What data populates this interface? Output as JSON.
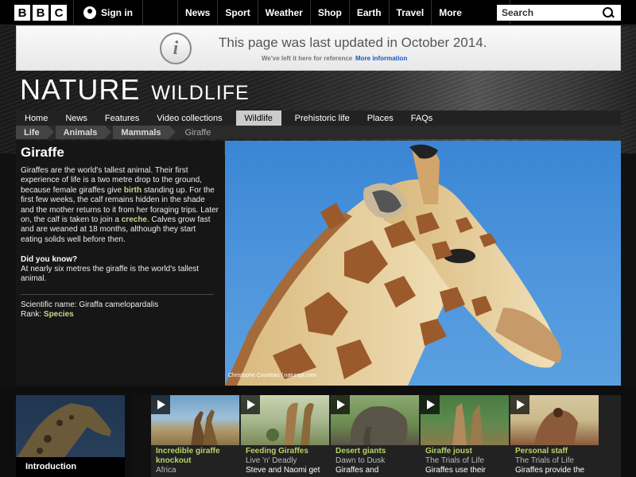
{
  "topbar": {
    "logo_letters": [
      "B",
      "B",
      "C"
    ],
    "signin_label": "Sign in",
    "nav": [
      "News",
      "Sport",
      "Weather",
      "Shop",
      "Earth",
      "Travel"
    ],
    "more_label": "More",
    "search_placeholder": "Search"
  },
  "notice": {
    "icon": "i",
    "title": "This page was last updated in October 2014.",
    "subtitle": "We've left it here for reference",
    "link": "More information"
  },
  "header": {
    "title": "NATURE",
    "subtitle": "WILDLIFE"
  },
  "section_nav": {
    "items": [
      "Home",
      "News",
      "Features",
      "Video collections",
      "Wildlife",
      "Prehistoric life",
      "Places",
      "FAQs"
    ],
    "active_index": 4
  },
  "breadcrumb": [
    "Life",
    "Animals",
    "Mammals",
    "Giraffe"
  ],
  "species": {
    "name": "Giraffe",
    "desc_part1": "Giraffes are the world's tallest animal. Their first experience of life is a two metre drop to the ground, because female giraffes give ",
    "desc_link1": "birth",
    "desc_part2": " standing up. For the first few weeks, the calf remains hidden in the shade and the mother returns to it from her foraging trips. Later on, the calf is taken to join a ",
    "desc_link2": "creche",
    "desc_part3": ". Calves grow fast and are weaned at 18 months, although they start eating solids well before then.",
    "did_you_know_title": "Did you know?",
    "did_you_know_text": "At nearly six metres the giraffe is the world's tallest animal.",
    "scientific_name": "Scientific name: Giraffa camelopardalis",
    "rank_label": "Rank: ",
    "rank_value": "Species",
    "image_credit": "Christophe Courteau / naturepl.com"
  },
  "intro_label": "Introduction",
  "clips": [
    {
      "title": "Incredible giraffe knockout",
      "subtitle": "Africa",
      "colors": [
        "#6fa0c8",
        "#b09a6a"
      ]
    },
    {
      "title": "Feeding Giraffes",
      "subtitle": "Live 'n' Deadly",
      "extra": "Steve and Naomi get",
      "colors": [
        "#a8b890",
        "#7a8a5a"
      ]
    },
    {
      "title": "Desert giants",
      "subtitle": "Dawn to Dusk",
      "extra": "Giraffes and",
      "colors": [
        "#8aa870",
        "#5b5448"
      ]
    },
    {
      "title": "Giraffe joust",
      "subtitle": "The Trials of Life",
      "extra": "Giraffes use their",
      "colors": [
        "#5a8a50",
        "#8a7a4a"
      ]
    },
    {
      "title": "Personal staff",
      "subtitle": "The Trials of Life",
      "extra": "Giraffes provide the",
      "colors": [
        "#c8b88a",
        "#8a5a3a"
      ]
    }
  ]
}
